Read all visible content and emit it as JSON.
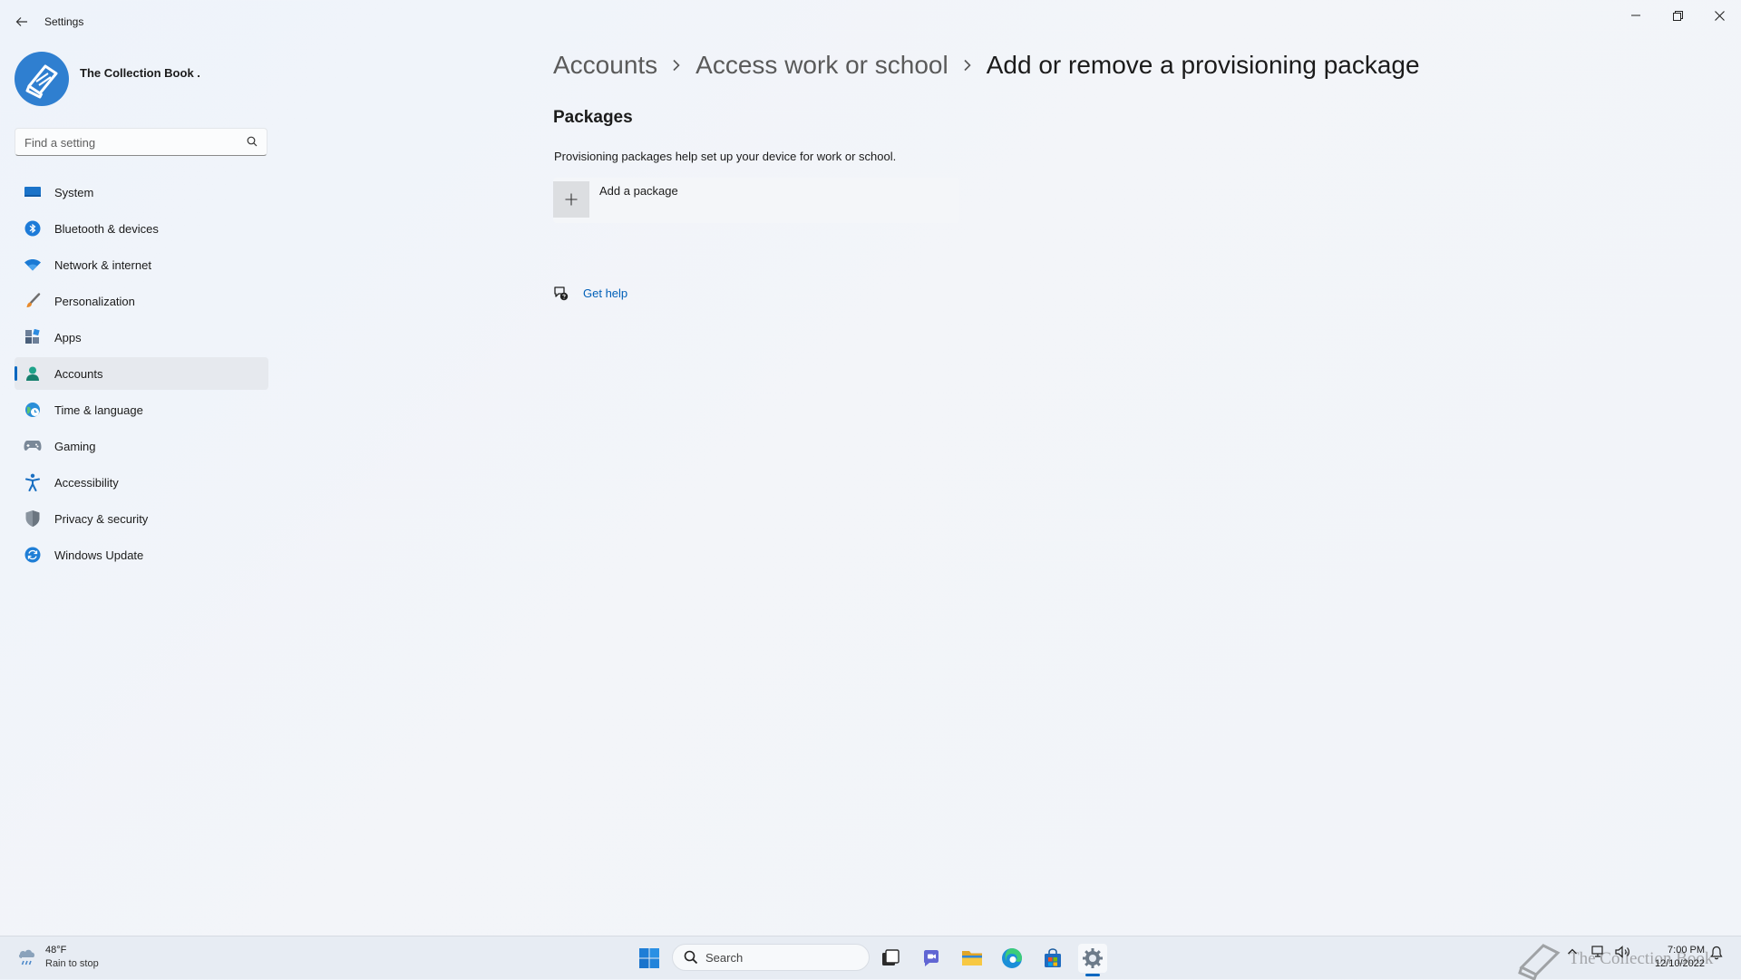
{
  "window": {
    "title": "Settings"
  },
  "profile": {
    "name": "The Collection Book ."
  },
  "search": {
    "placeholder": "Find a setting"
  },
  "sidebar": {
    "items": [
      {
        "label": "System",
        "icon": "monitor-icon"
      },
      {
        "label": "Bluetooth & devices",
        "icon": "bluetooth-icon"
      },
      {
        "label": "Network & internet",
        "icon": "wifi-icon"
      },
      {
        "label": "Personalization",
        "icon": "brush-icon"
      },
      {
        "label": "Apps",
        "icon": "apps-icon"
      },
      {
        "label": "Accounts",
        "icon": "person-icon",
        "active": true
      },
      {
        "label": "Time & language",
        "icon": "globe-clock-icon"
      },
      {
        "label": "Gaming",
        "icon": "gamepad-icon"
      },
      {
        "label": "Accessibility",
        "icon": "accessibility-icon"
      },
      {
        "label": "Privacy & security",
        "icon": "shield-icon"
      },
      {
        "label": "Windows Update",
        "icon": "update-icon"
      }
    ]
  },
  "breadcrumb": {
    "level1": "Accounts",
    "level2": "Access work or school",
    "current": "Add or remove a provisioning package"
  },
  "main": {
    "section_title": "Packages",
    "description": "Provisioning packages help set up your device for work or school.",
    "add_package_label": "Add a package",
    "get_help_label": "Get help"
  },
  "taskbar": {
    "weather_temp": "48°F",
    "weather_condition": "Rain to stop",
    "search_label": "Search",
    "time": "7:00 PM",
    "date": "12/10/2022",
    "watermark": "The Collection Book"
  },
  "colors": {
    "accent": "#0067c0",
    "link": "#005fb8"
  }
}
